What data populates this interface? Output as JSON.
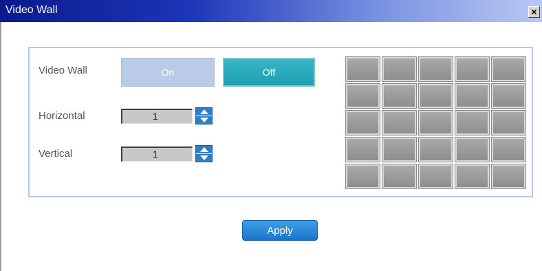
{
  "window": {
    "title": "Video Wall",
    "close_label": "×"
  },
  "form": {
    "video_wall_label": "Video Wall",
    "on_label": "On",
    "off_label": "Off",
    "selected_mode": "Off",
    "horizontal_label": "Horizontal",
    "horizontal_value": "1",
    "vertical_label": "Vertical",
    "vertical_value": "1"
  },
  "grid": {
    "rows": 5,
    "columns": 5
  },
  "actions": {
    "apply_label": "Apply"
  },
  "colors": {
    "title_bar": "#0a1a8c",
    "off_active": "#1f9fb3",
    "on_inactive": "#b9cbe6",
    "apply": "#1b73c9",
    "grid_cell": "#8e8e8e"
  }
}
